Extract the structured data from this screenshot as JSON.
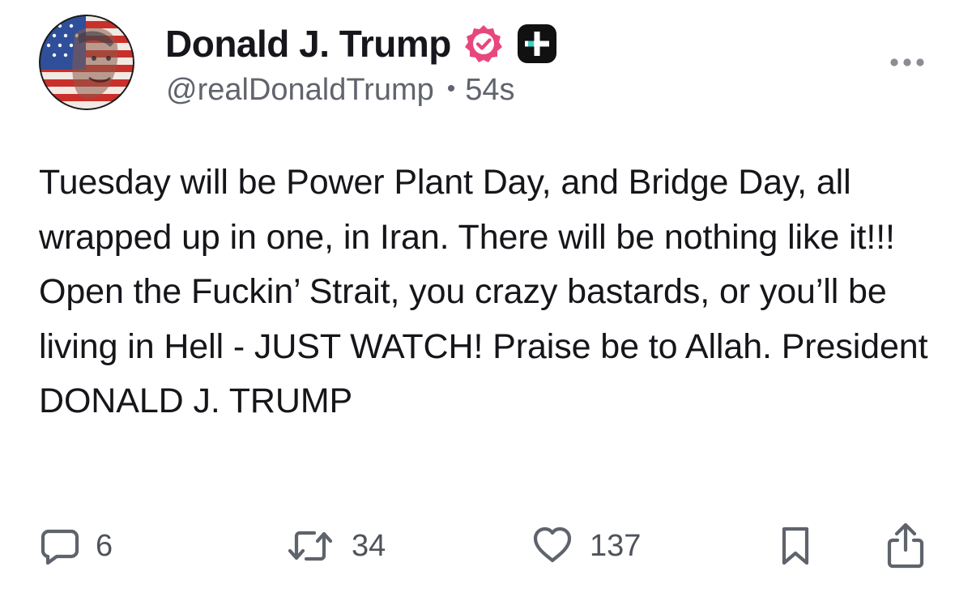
{
  "author": {
    "display_name": "Donald J. Trump",
    "handle": "@realDonaldTrump",
    "separator": "•",
    "time_ago": "54s",
    "verified_color": "#e8477e",
    "plus_badge_color": "#111111",
    "plus_badge_accent": "#3fd0c4"
  },
  "post": {
    "text": "Tuesday will be Power Plant Day, and Bridge Day, all wrapped up in one, in Iran. There will be nothing like it!!! Open the Fuckin’ Strait, you crazy bastards, or you’ll be living in Hell - JUST WATCH! Praise be to Allah. President DONALD J. TRUMP"
  },
  "actions": {
    "replies": "6",
    "reposts": "34",
    "likes": "137"
  },
  "icons": {
    "avatar": "avatar-flag-portrait",
    "verified": "verified-badge-icon",
    "plus": "plus-badge-icon",
    "more": "more-dots-icon",
    "reply": "comment-icon",
    "repost": "repost-icon",
    "like": "heart-icon",
    "bookmark": "bookmark-icon",
    "share": "share-icon"
  }
}
